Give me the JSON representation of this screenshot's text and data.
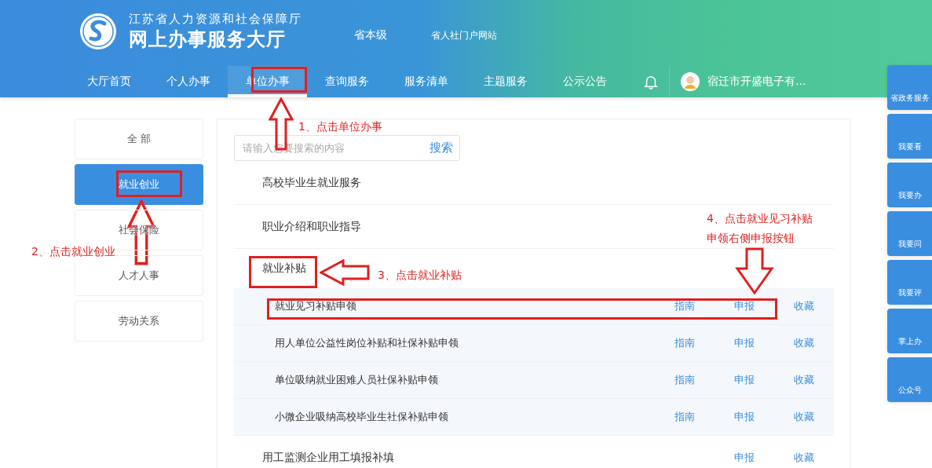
{
  "header": {
    "org": "江苏省人力资源和社会保障厅",
    "title": "网上办事服务大厅",
    "links": [
      "省本级",
      "省人社门户网站"
    ]
  },
  "nav": [
    {
      "label": "大厅首页",
      "selected": false
    },
    {
      "label": "个人办事",
      "selected": false
    },
    {
      "label": "单位办事",
      "selected": true
    },
    {
      "label": "查询服务",
      "selected": false
    },
    {
      "label": "服务清单",
      "selected": false
    },
    {
      "label": "主题服务",
      "selected": false
    },
    {
      "label": "公示公告",
      "selected": false
    }
  ],
  "user": {
    "name": "宿迁市开盛电子有..."
  },
  "sidebar": {
    "items": [
      {
        "label": "全 部",
        "selected": false
      },
      {
        "label": "就业创业",
        "selected": true
      },
      {
        "label": "社会保险",
        "selected": false
      },
      {
        "label": "人才人事",
        "selected": false
      },
      {
        "label": "劳动关系",
        "selected": false
      }
    ]
  },
  "search": {
    "placeholder": "请输入您要搜索的内容",
    "button": "搜索"
  },
  "categories": [
    {
      "label": "高校毕业生就业服务",
      "expanded": false
    },
    {
      "label": "职业介绍和职业指导",
      "expanded": false
    },
    {
      "label": "就业补贴",
      "expanded": true,
      "children": [
        {
          "label": "就业见习补贴申领",
          "actions": [
            "指南",
            "申报",
            "收藏"
          ]
        },
        {
          "label": "用人单位公益性岗位补贴和社保补贴申领",
          "actions": [
            "指南",
            "申报",
            "收藏"
          ]
        },
        {
          "label": "单位吸纳就业困难人员社保补贴申领",
          "actions": [
            "指南",
            "申报",
            "收藏"
          ]
        },
        {
          "label": "小微企业吸纳高校毕业生社保补贴申领",
          "actions": [
            "指南",
            "申报",
            "收藏"
          ]
        }
      ]
    },
    {
      "label": "用工监测企业用工填报补填",
      "expanded": false,
      "actions": [
        "申报",
        "收藏"
      ]
    }
  ],
  "float_buttons": [
    "省政务服务",
    "我要看",
    "我要办",
    "我要问",
    "我要评",
    "掌上办",
    "公众号"
  ],
  "annotations": [
    {
      "kind": "box"
    },
    {
      "kind": "arrow-up"
    },
    {
      "kind": "note",
      "text": "1、点击单位办事"
    },
    {
      "kind": "box"
    },
    {
      "kind": "arrow-up"
    },
    {
      "kind": "note",
      "text": "2、点击就业创业"
    },
    {
      "kind": "box"
    },
    {
      "kind": "arrow-left"
    },
    {
      "kind": "note",
      "text": "3、点击就业补贴"
    },
    {
      "kind": "note",
      "text": "4、点击就业见习补贴"
    },
    {
      "kind": "note",
      "text": "申领右侧申报按钮"
    },
    {
      "kind": "arrow-down"
    },
    {
      "kind": "box"
    }
  ]
}
